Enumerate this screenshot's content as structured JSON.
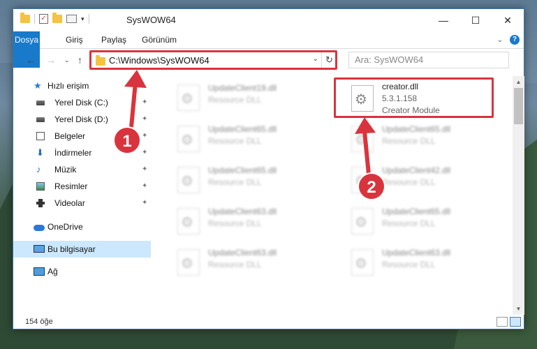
{
  "window": {
    "title": "SysWOW64",
    "minimize_glyph": "—",
    "maximize_glyph": "☐",
    "close_glyph": "✕"
  },
  "ribbon": {
    "tabs": [
      "Dosya",
      "Giriş",
      "Paylaş",
      "Görünüm"
    ],
    "help_glyph": "?",
    "collapse_glyph": "⌄"
  },
  "nav": {
    "back_glyph": "←",
    "forward_glyph": "→",
    "recent_glyph": "⌄",
    "up_glyph": "↑",
    "address": "C:\\Windows\\SysWOW64",
    "address_dropdown_glyph": "⌄",
    "refresh_glyph": "↻",
    "search_placeholder": "Ara: SysWOW64"
  },
  "sidebar": {
    "items": [
      {
        "label": "Hızlı erişim",
        "icon": "star-icon",
        "pinned": false
      },
      {
        "label": "Yerel Disk (C:)",
        "icon": "disk-icon",
        "pinned": true
      },
      {
        "label": "Yerel Disk (D:)",
        "icon": "disk-icon",
        "pinned": true
      },
      {
        "label": "Belgeler",
        "icon": "document-icon",
        "pinned": true
      },
      {
        "label": "İndirmeler",
        "icon": "download-icon",
        "pinned": true
      },
      {
        "label": "Müzik",
        "icon": "music-icon",
        "pinned": true
      },
      {
        "label": "Resimler",
        "icon": "pictures-icon",
        "pinned": true
      },
      {
        "label": "Videolar",
        "icon": "videos-icon",
        "pinned": true
      },
      {
        "label": "OneDrive",
        "icon": "cloud-icon",
        "pinned": false
      },
      {
        "label": "Bu bilgisayar",
        "icon": "computer-icon",
        "pinned": false,
        "selected": true
      },
      {
        "label": "Ağ",
        "icon": "network-icon",
        "pinned": false
      }
    ],
    "pin_glyph": "📌"
  },
  "files": {
    "left_column": [
      {
        "name": "UpdateClient19.dll",
        "type": "Resource DLL"
      },
      {
        "name": "UpdateClient65.dll",
        "type": "Resource DLL"
      },
      {
        "name": "UpdateClient65.dll",
        "type": "Resource DLL"
      },
      {
        "name": "UpdateClient63.dll",
        "type": "Resource DLL"
      },
      {
        "name": "UpdateClient63.dll",
        "type": "Resource DLL"
      }
    ],
    "highlighted": {
      "name": "creator.dll",
      "version": "5.3.1.158",
      "description": "Creator Module"
    },
    "right_column": [
      {
        "name": "UpdateClient65.dll",
        "type": "Resource DLL"
      },
      {
        "name": "UpdateClient42.dll",
        "type": "Resource DLL"
      },
      {
        "name": "UpdateClient65.dll",
        "type": "Resource DLL"
      },
      {
        "name": "UpdateClient63.dll",
        "type": "Resource DLL"
      }
    ]
  },
  "statusbar": {
    "item_count": "154 öğe"
  },
  "annotations": {
    "step1": "1",
    "step2": "2",
    "color": "#d9343d"
  }
}
